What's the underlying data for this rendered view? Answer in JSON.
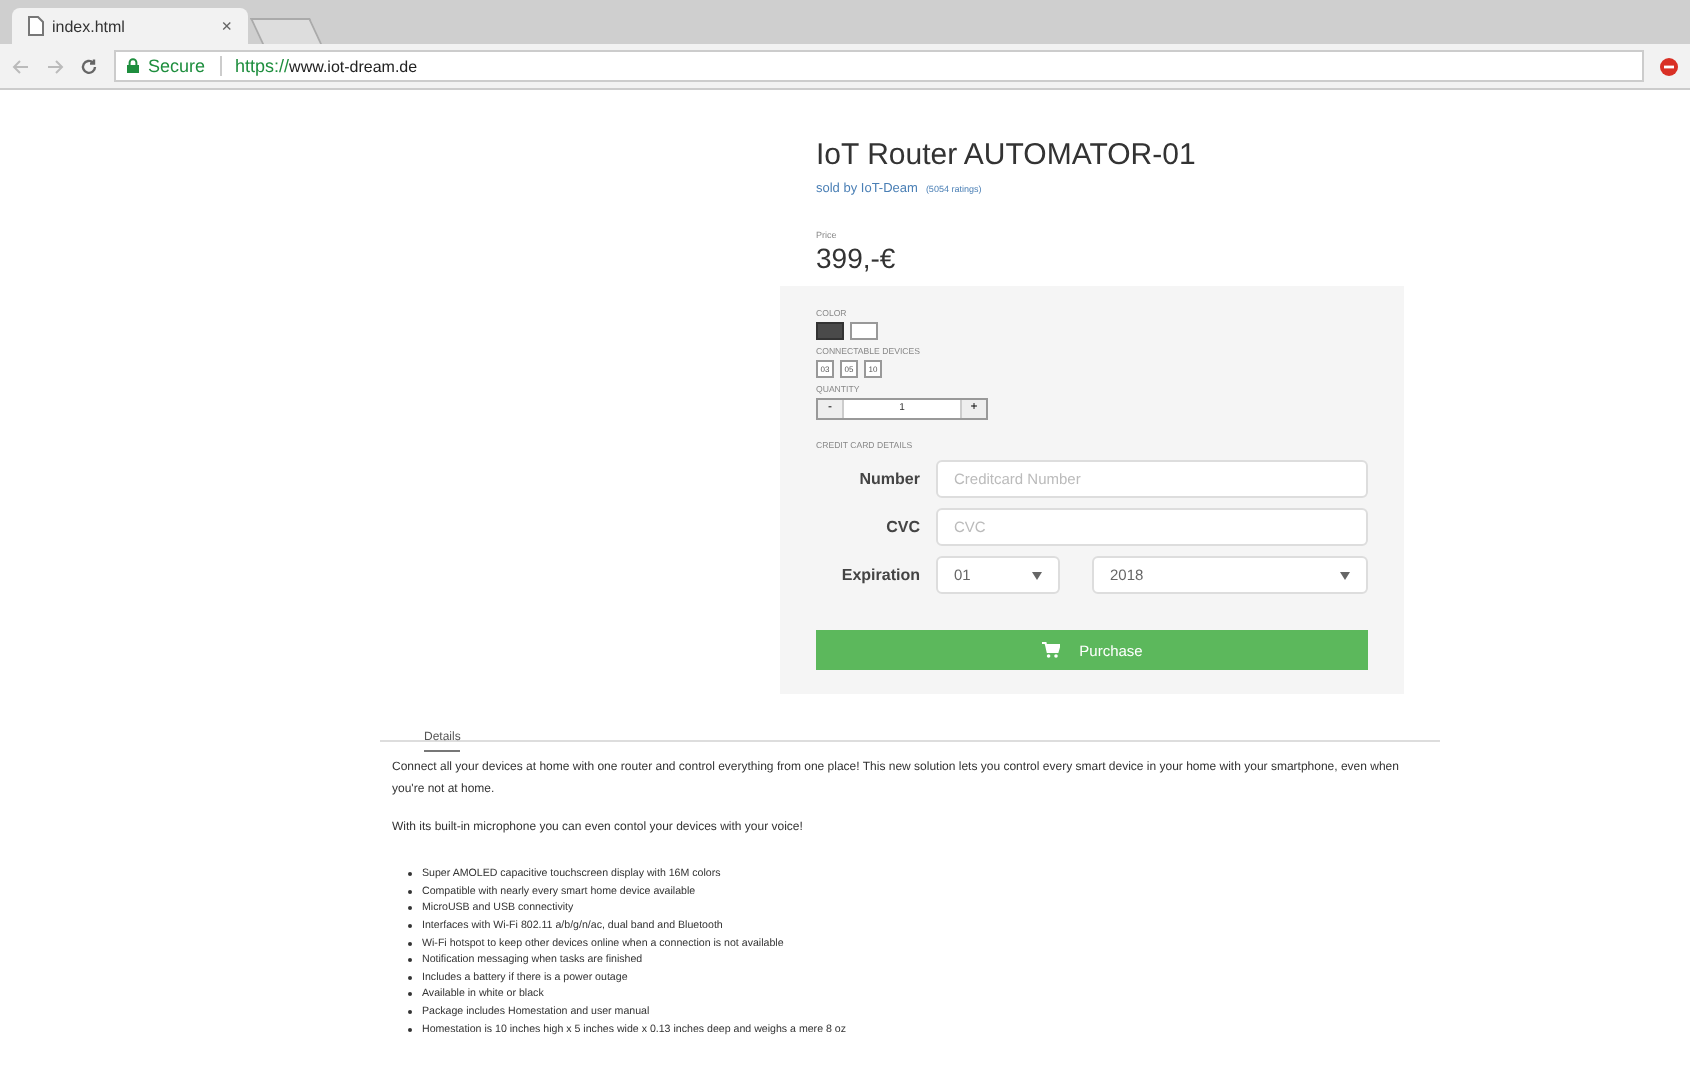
{
  "browser": {
    "tab_title": "index.html",
    "tab_close": "×",
    "secure_label": "Secure",
    "url_scheme": "https://",
    "url_rest": "www.iot-dream.de"
  },
  "product": {
    "title": "IoT Router AUTOMATOR-01",
    "seller": "sold by IoT-Deam",
    "ratings": "(5054 ratings)",
    "price_label": "Price",
    "price": "399,-€"
  },
  "options": {
    "color_label": "COLOR",
    "colors": [
      {
        "color": "#4a4a4a",
        "selected": true
      },
      {
        "color": "#ffffff",
        "selected": false
      }
    ],
    "devices_label": "CONNECTABLE DEVICES",
    "devices": [
      {
        "label": "03",
        "selected": false
      },
      {
        "label": "05",
        "selected": false
      },
      {
        "label": "10",
        "selected": false
      }
    ],
    "quantity_label": "QUANTITY",
    "minus": "-",
    "quantity": "1",
    "plus": "+"
  },
  "card": {
    "section_label": "CREDIT CARD DETAILS",
    "number_label": "Number",
    "number_placeholder": "Creditcard Number",
    "cvc_label": "CVC",
    "cvc_placeholder": "CVC",
    "expiration_label": "Expiration",
    "month": "01",
    "year": "2018",
    "purchase": "Purchase"
  },
  "details": {
    "tab": "Details",
    "paragraphs": [
      "Connect all your devices at home with one router and control everything from one place! This new solution lets you control every smart device in your home with your smartphone, even when you're not at home.",
      "With its built-in microphone you can even contol your devices with your voice!"
    ],
    "bullets": [
      "Super AMOLED capacitive touchscreen display with 16M colors",
      "Compatible with nearly every smart home device available",
      "MicroUSB and USB connectivity",
      "Interfaces with Wi-Fi 802.11 a/b/g/n/ac, dual band and Bluetooth",
      "Wi-Fi hotspot to keep other devices online when a connection is not available",
      "Notification messaging when tasks are finished",
      "Includes a battery if there is a power outage",
      "Available in white or black",
      "Package includes Homestation and user manual",
      "Homestation is 10 inches high x 5 inches wide x 0.13 inches deep and weighs a mere 8 oz"
    ]
  }
}
